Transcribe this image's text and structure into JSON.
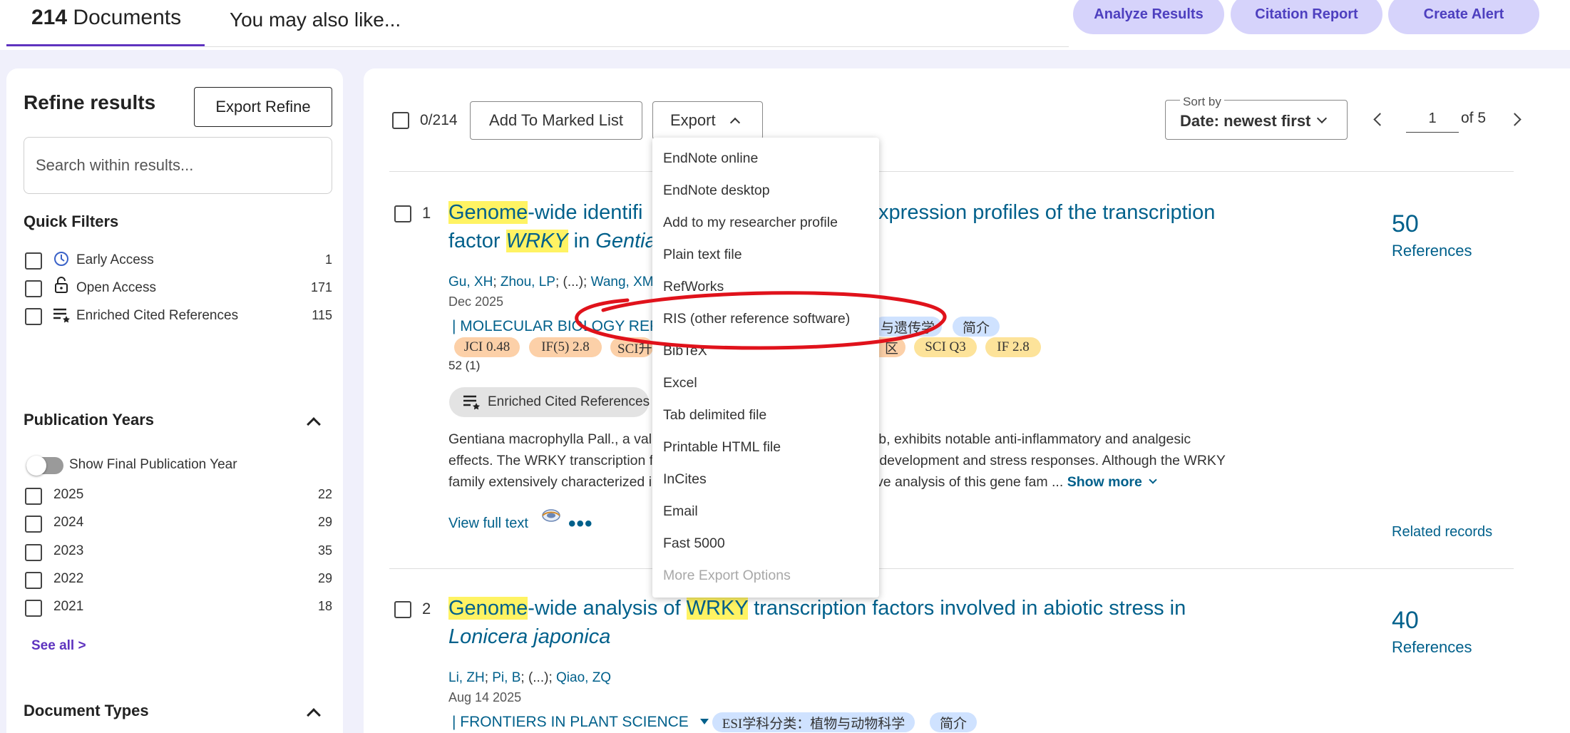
{
  "tabs": {
    "documents_count": "214",
    "documents_label": "Documents",
    "also_like": "You may also like..."
  },
  "top_actions": {
    "analyze": "Analyze Results",
    "citation": "Citation Report",
    "alert": "Create Alert"
  },
  "refine": {
    "title": "Refine results",
    "export_refine": "Export Refine",
    "search_placeholder": "Search within results...",
    "quick_filters_title": "Quick Filters",
    "quick_filters": [
      {
        "label": "Early Access",
        "count": "1",
        "icon": "clock-icon"
      },
      {
        "label": "Open Access",
        "count": "171",
        "icon": "lock-open-icon"
      },
      {
        "label": "Enriched Cited References",
        "count": "115",
        "icon": "enriched-list-icon"
      }
    ],
    "pub_years_title": "Publication Years",
    "show_final_label": "Show Final Publication Year",
    "years": [
      {
        "label": "2025",
        "count": "22"
      },
      {
        "label": "2024",
        "count": "29"
      },
      {
        "label": "2023",
        "count": "35"
      },
      {
        "label": "2022",
        "count": "29"
      },
      {
        "label": "2021",
        "count": "18"
      }
    ],
    "see_all": "See all >",
    "doc_types_title": "Document Types"
  },
  "toolbar": {
    "selected": "0/214",
    "add_marked": "Add To Marked List",
    "export": "Export",
    "sort_by_label": "Sort by",
    "sort_value": "Date: newest first",
    "page": "1",
    "of_pages": "of 5"
  },
  "export_menu": [
    "EndNote online",
    "EndNote desktop",
    "Add to my researcher profile",
    "Plain text file",
    "RefWorks",
    "RIS (other reference software)",
    "BibTeX",
    "Excel",
    "Tab delimited file",
    "Printable HTML file",
    "InCites",
    "Email",
    "Fast 5000",
    "More Export Options"
  ],
  "results": [
    {
      "num": "1",
      "title_parts": [
        "Genome",
        "-wide identifi",
        "l expression profiles of the transcription",
        "factor ",
        "WRKY",
        " in ",
        "Gentian"
      ],
      "authors": [
        "Gu, XH",
        "Zhou, LP",
        "(...)",
        "Wang, XM"
      ],
      "date": "Dec 2025",
      "journal": "| MOLECULAR BIOLOGY REPO",
      "badges_row1": [
        "与遗传学",
        "简介"
      ],
      "badges_row2": [
        "JCI 0.48",
        "IF(5) 2.8",
        "SCI升",
        "区",
        "SCI Q3",
        "IF 2.8"
      ],
      "citations_note": "52 (1)",
      "ecr_label": "Enriched Cited References",
      "abstract_lines": [
        "Gentiana macrophylla Pall., a val",
        "herb, exhibits notable anti-inflammatory and analgesic",
        "effects. The WRKY transcription fa",
        "g development and stress responses. Although the WRKY",
        "family extensively characterized i",
        "nsive analysis of this gene fam ..."
      ],
      "show_more": "Show more",
      "view_full_text": "View full text",
      "references_count": "50",
      "references_label": "References",
      "related": "Related records"
    },
    {
      "num": "2",
      "title_parts": [
        "Genome",
        "-wide analysis of ",
        "WRKY",
        " transcription factors involved in abiotic stress in",
        "Lonicera japonica"
      ],
      "authors": [
        "Li, ZH",
        "Pi, B",
        "(...)",
        "Qiao, ZQ"
      ],
      "date": "Aug 14 2025",
      "journal": "| FRONTIERS IN PLANT SCIENCE",
      "badges_row1": [
        "ESI学科分类：植物与动物科学",
        "简介"
      ],
      "references_count": "40",
      "references_label": "References"
    }
  ],
  "colors": {
    "accent_purple": "#5e33bf",
    "link_blue": "#00608b",
    "highlight": "#fff363",
    "annotation_red": "#e0121b"
  }
}
